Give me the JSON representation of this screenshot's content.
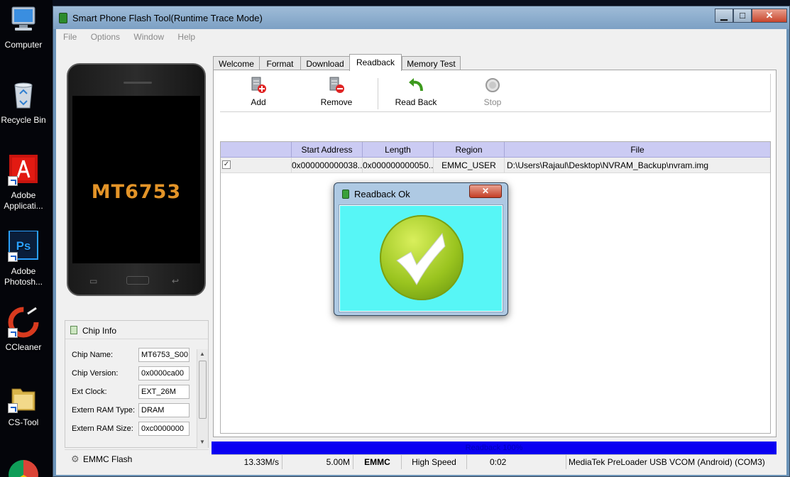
{
  "desktop": {
    "icons": [
      {
        "label": "Computer"
      },
      {
        "label": "Recycle Bin"
      },
      {
        "label": "Adobe Applicati..."
      },
      {
        "label": "Adobe Photosh..."
      },
      {
        "label": "CCleaner"
      },
      {
        "label": "CS-Tool"
      }
    ]
  },
  "window": {
    "title": "Smart Phone Flash Tool(Runtime Trace Mode)",
    "min_label": "▁",
    "max_label": "□",
    "close_label": "✕"
  },
  "menu": [
    "File",
    "Options",
    "Window",
    "Help"
  ],
  "phone": {
    "model": "MT6753"
  },
  "chip_info": {
    "title": "Chip Info",
    "rows": [
      {
        "label": "Chip Name:",
        "value": "MT6753_S00"
      },
      {
        "label": "Chip Version:",
        "value": "0x0000ca00"
      },
      {
        "label": "Ext Clock:",
        "value": "EXT_26M"
      },
      {
        "label": "Extern RAM Type:",
        "value": "DRAM"
      },
      {
        "label": "Extern RAM Size:",
        "value": "0xc0000000"
      }
    ]
  },
  "emmc_flash": {
    "label": "EMMC Flash"
  },
  "tabs": [
    "Welcome",
    "Format",
    "Download",
    "Readback",
    "Memory Test"
  ],
  "active_tab": "Readback",
  "toolbar": {
    "add": "Add",
    "remove": "Remove",
    "read_back": "Read Back",
    "stop": "Stop"
  },
  "table": {
    "headers": [
      "Start Address",
      "Length",
      "Region",
      "File"
    ],
    "rows": [
      {
        "checked": true,
        "start": "0x000000000038...",
        "length": "0x000000000050...",
        "region": "EMMC_USER",
        "file": "D:\\Users\\Rajaul\\Desktop\\NVRAM_Backup\\nvram.img"
      }
    ]
  },
  "progress": {
    "text": "Readback 100%",
    "percent": 100
  },
  "status": {
    "speed": "13.33M/s",
    "size": "5.00M",
    "storage": "EMMC",
    "usb_speed": "High Speed",
    "time": "0:02",
    "port": "MediaTek PreLoader USB VCOM (Android) (COM3)"
  },
  "dialog": {
    "title": "Readback Ok",
    "close_label": "✕"
  },
  "colors": {
    "header_bg": "#cbcbf3",
    "progress": "#0a00f2",
    "dialog_content": "#57f6f6",
    "check_green": "#9ac41f",
    "phone_model": "#e39428"
  }
}
